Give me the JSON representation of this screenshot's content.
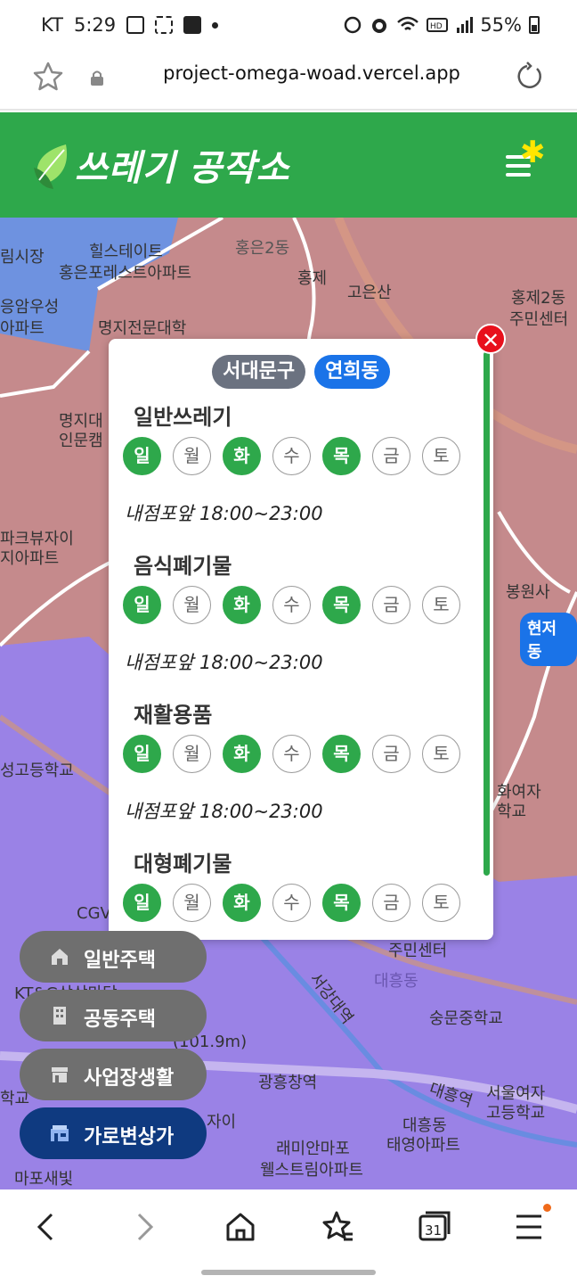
{
  "status_bar": {
    "carrier": "KT",
    "time": "5:29",
    "battery": "55%",
    "icons": [
      "image-icon",
      "screen-record-icon",
      "calendar-icon",
      "dot-icon",
      "sync-icon",
      "alarm-icon",
      "wifi-icon",
      "hd-icon",
      "signal-icon",
      "battery-icon"
    ]
  },
  "browser": {
    "url": "project-omega-woad.vercel.app",
    "icons": [
      "star-icon",
      "lock-icon",
      "reload-icon"
    ]
  },
  "header": {
    "title": "쓰레기 공작소",
    "brand_color": "#2ea84b",
    "icons": [
      "leaf-logo-icon",
      "menu-icon"
    ]
  },
  "map": {
    "labels": [
      "림시장",
      "힐스테이트",
      "홍은2동",
      "홍은포레스트아파트",
      "홍제",
      "고은산",
      "홍제2동",
      "주민센터",
      "응암우성",
      "아파트",
      "명지전문대학",
      "명지대",
      "인문캠",
      "파크뷰자이",
      "지아파트",
      "봉원사",
      "성고등학교",
      "현저동",
      "화여자",
      "학교",
      "CGV",
      "KT&G상상마당",
      "주민센터",
      "대흥동",
      "숭문중학교",
      "광흥창역",
      "서강대역",
      "대흥역",
      "서울여자",
      "고등학교",
      "대흥동",
      "태영아파트",
      "래미안마포",
      "웰스트림아파트",
      "마포새빛",
      "(101.9m)",
      "학교",
      "자이"
    ],
    "highlight_badge": "현저동"
  },
  "popup": {
    "district": "서대문구",
    "dong": "연희동",
    "sections": [
      {
        "title": "일반쓰레기",
        "days": [
          "일",
          "월",
          "화",
          "수",
          "목",
          "금",
          "토"
        ],
        "active": [
          true,
          false,
          true,
          false,
          true,
          false,
          false
        ],
        "place_time": "내점포앞 18:00~23:00"
      },
      {
        "title": "음식폐기물",
        "days": [
          "일",
          "월",
          "화",
          "수",
          "목",
          "금",
          "토"
        ],
        "active": [
          true,
          false,
          true,
          false,
          true,
          false,
          false
        ],
        "place_time": "내점포앞 18:00~23:00"
      },
      {
        "title": "재활용품",
        "days": [
          "일",
          "월",
          "화",
          "수",
          "목",
          "금",
          "토"
        ],
        "active": [
          true,
          false,
          true,
          false,
          true,
          false,
          false
        ],
        "place_time": "내점포앞 18:00~23:00"
      },
      {
        "title": "대형폐기물",
        "days": [
          "일",
          "월",
          "화",
          "수",
          "목",
          "금",
          "토"
        ],
        "active": [
          true,
          false,
          true,
          false,
          true,
          false,
          false
        ],
        "place_time": ""
      }
    ],
    "close_icon": "close-icon",
    "active_color": "#2ea84b"
  },
  "categories": [
    {
      "label": "일반주택",
      "icon": "house-icon",
      "active": false
    },
    {
      "label": "공동주택",
      "icon": "apartment-icon",
      "active": false
    },
    {
      "label": "사업장생활",
      "icon": "store-icon",
      "active": false
    },
    {
      "label": "가로변상가",
      "icon": "street-shop-icon",
      "active": true
    }
  ],
  "bottom_nav": {
    "items": [
      "back-icon",
      "forward-icon",
      "home-icon",
      "bookmarks-icon",
      "tabs-icon",
      "menu-icon"
    ],
    "tabs_count": "31"
  }
}
